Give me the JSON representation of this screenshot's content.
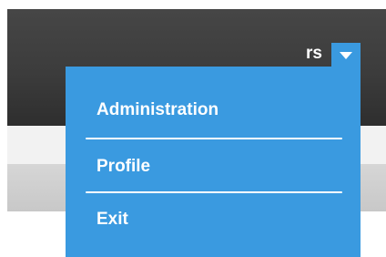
{
  "header": {
    "username": "rs",
    "dropdown_icon": "caret-down-icon"
  },
  "menu": {
    "items": [
      {
        "label": "Administration"
      },
      {
        "label": "Profile"
      },
      {
        "label": "Exit"
      }
    ]
  },
  "colors": {
    "menu_background": "#3a9ae0",
    "header_background": "#3c3c3c",
    "text": "#ffffff"
  }
}
